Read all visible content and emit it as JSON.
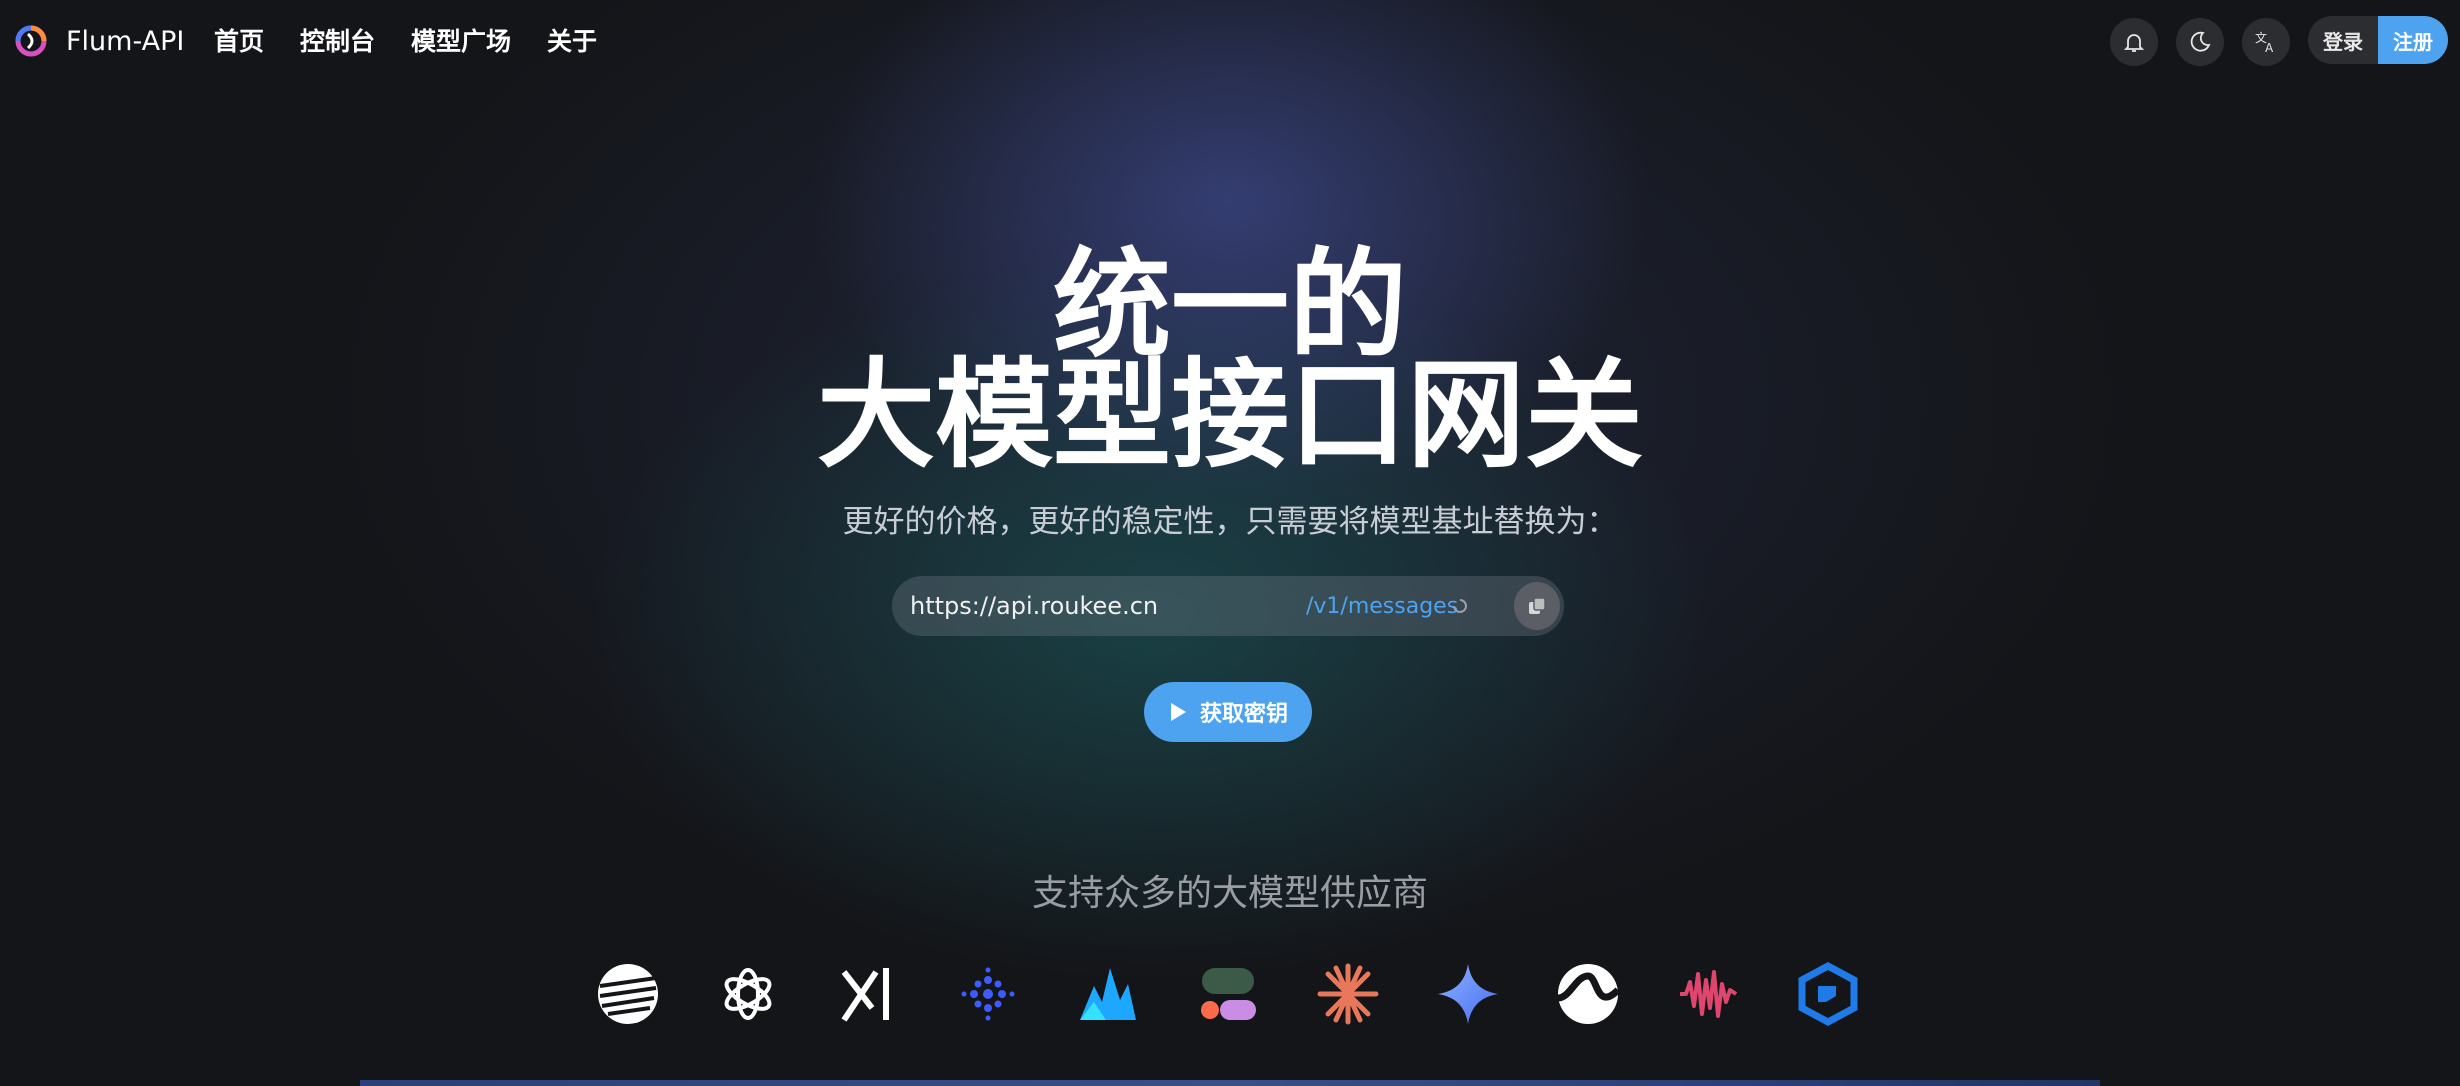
{
  "header": {
    "brand": "Flum-API",
    "nav": [
      "首页",
      "控制台",
      "模型广场",
      "关于"
    ],
    "login_label": "登录",
    "register_label": "注册"
  },
  "hero": {
    "line1": "统一的",
    "line2": "大模型接口网关",
    "subtitle": "更好的价格，更好的稳定性，只需要将模型基址替换为："
  },
  "url_bar": {
    "base_url": "https://api.roukee.cn",
    "path": "/v1/messages"
  },
  "cta_label": "获取密钥",
  "providers": {
    "title": "支持众多的大模型供应商",
    "icons": [
      "stripes-logo-icon",
      "openai-logo-icon",
      "xai-logo-icon",
      "dots-logo-icon",
      "peaks-logo-icon",
      "blob-logo-icon",
      "asterisk-logo-icon",
      "gemini-star-icon",
      "wave-s-logo-icon",
      "soundwave-logo-icon",
      "cube-logo-icon"
    ]
  },
  "colors": {
    "accent": "#4da3f0",
    "background": "#141519"
  }
}
